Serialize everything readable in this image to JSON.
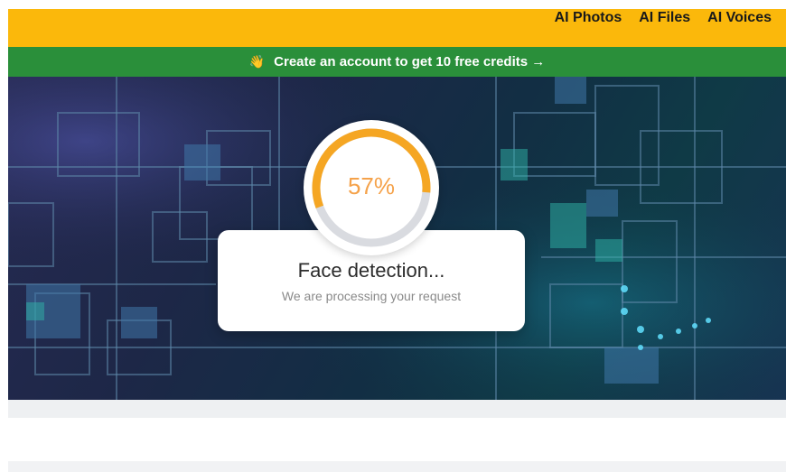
{
  "nav": {
    "items": [
      "AI Photos",
      "AI Files",
      "AI Voices"
    ]
  },
  "promo": {
    "icon": "waving-hand-icon",
    "text": "Create an account to get 10 free credits →"
  },
  "progress": {
    "percent_label": "57%",
    "value": 0.57,
    "color": "#f5a623",
    "track_color": "#d9dbe0"
  },
  "status": {
    "title": "Face detection...",
    "subtitle": "We are processing your request"
  },
  "colors": {
    "topbar": "#fbb80b",
    "promo": "#2a8f3a"
  }
}
